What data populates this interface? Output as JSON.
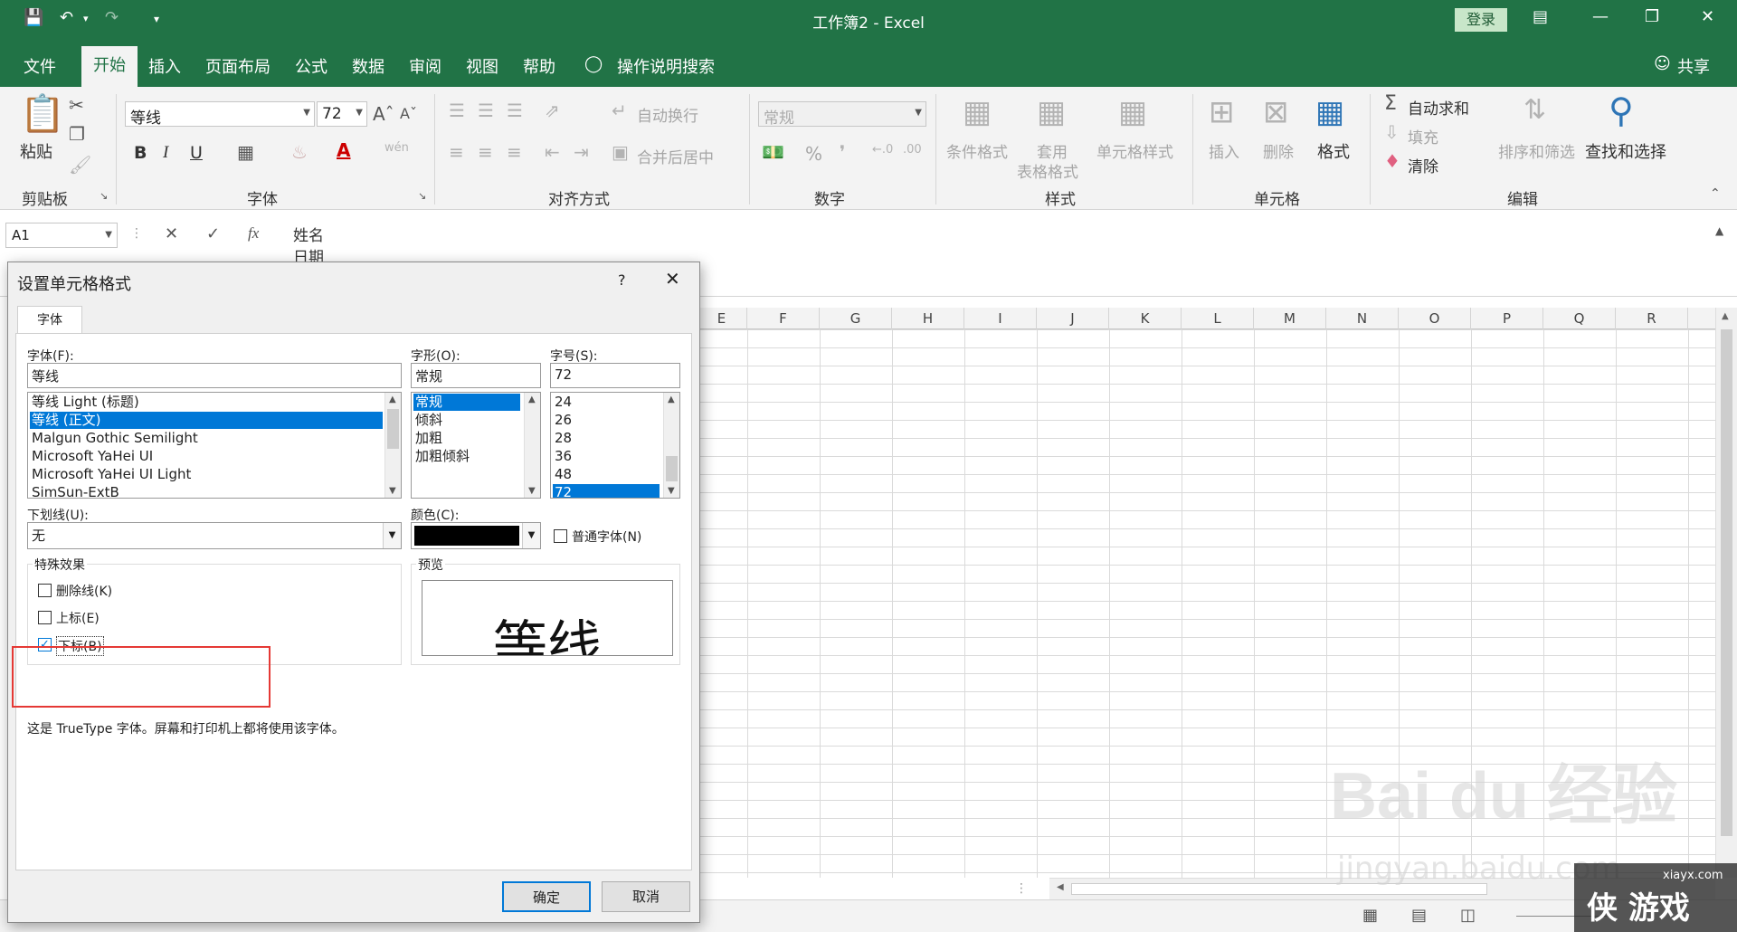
{
  "window": {
    "title": "工作簿2  -  Excel",
    "login": "登录"
  },
  "tabs": [
    "文件",
    "开始",
    "插入",
    "页面布局",
    "公式",
    "数据",
    "审阅",
    "视图",
    "帮助"
  ],
  "tell_me": "操作说明搜索",
  "share": "共享",
  "ribbon": {
    "clipboard": {
      "label": "剪贴板",
      "paste": "粘贴"
    },
    "font": {
      "label": "字体",
      "font_name": "等线",
      "font_size": "72",
      "bold": "B",
      "italic": "I",
      "underline": "U",
      "wen": "wén"
    },
    "alignment": {
      "label": "对齐方式",
      "wrap": "自动换行",
      "merge": "合并后居中"
    },
    "number": {
      "label": "数字",
      "format": "常规",
      "percent": "%"
    },
    "styles": {
      "label": "样式",
      "conditional": "条件格式",
      "table_format_1": "套用",
      "table_format_2": "表格格式",
      "cell_styles": "单元格样式"
    },
    "cells": {
      "label": "单元格",
      "insert": "插入",
      "delete": "删除",
      "format": "格式"
    },
    "editing": {
      "label": "编辑",
      "autosum": "自动求和",
      "fill": "填充",
      "clear": "清除",
      "sort": "排序和筛选",
      "find": "查找和选择"
    }
  },
  "formula_bar": {
    "name_box": "A1",
    "content_line1": "姓名",
    "content_line2": "日期",
    "fx": "fx"
  },
  "columns": [
    "E",
    "F",
    "G",
    "H",
    "I",
    "J",
    "K",
    "L",
    "M",
    "N",
    "O",
    "P",
    "Q",
    "R"
  ],
  "dialog": {
    "title": "设置单元格格式",
    "help": "?",
    "tab": "字体",
    "font_label": "字体(F):",
    "font_value": "等线",
    "font_list": [
      "等线 Light (标题)",
      "等线 (正文)",
      "Malgun Gothic Semilight",
      "Microsoft YaHei UI",
      "Microsoft YaHei UI Light",
      "SimSun-ExtB"
    ],
    "style_label": "字形(O):",
    "style_value": "常规",
    "style_list": [
      "常规",
      "倾斜",
      "加粗",
      "加粗倾斜"
    ],
    "size_label": "字号(S):",
    "size_value": "72",
    "size_list": [
      "24",
      "26",
      "28",
      "36",
      "48",
      "72"
    ],
    "underline_label": "下划线(U):",
    "underline_value": "无",
    "color_label": "颜色(C):",
    "normal_font": "普通字体(N)",
    "effects_label": "特殊效果",
    "strikethrough": "删除线(K)",
    "superscript": "上标(E)",
    "subscript": "下标(B)",
    "preview_label": "预览",
    "preview_text": "等线",
    "info": "这是 TrueType 字体。屏幕和打印机上都将使用该字体。",
    "ok": "确定",
    "cancel": "取消"
  },
  "watermark": {
    "baidu": "Bai du 经验",
    "url": "jingyan.baidu.com",
    "site": "xiayx.com",
    "logo": "侠 游戏"
  },
  "colors": {
    "excel_green": "#217346",
    "selection_blue": "#0078d7",
    "highlight_red": "#e53935"
  }
}
